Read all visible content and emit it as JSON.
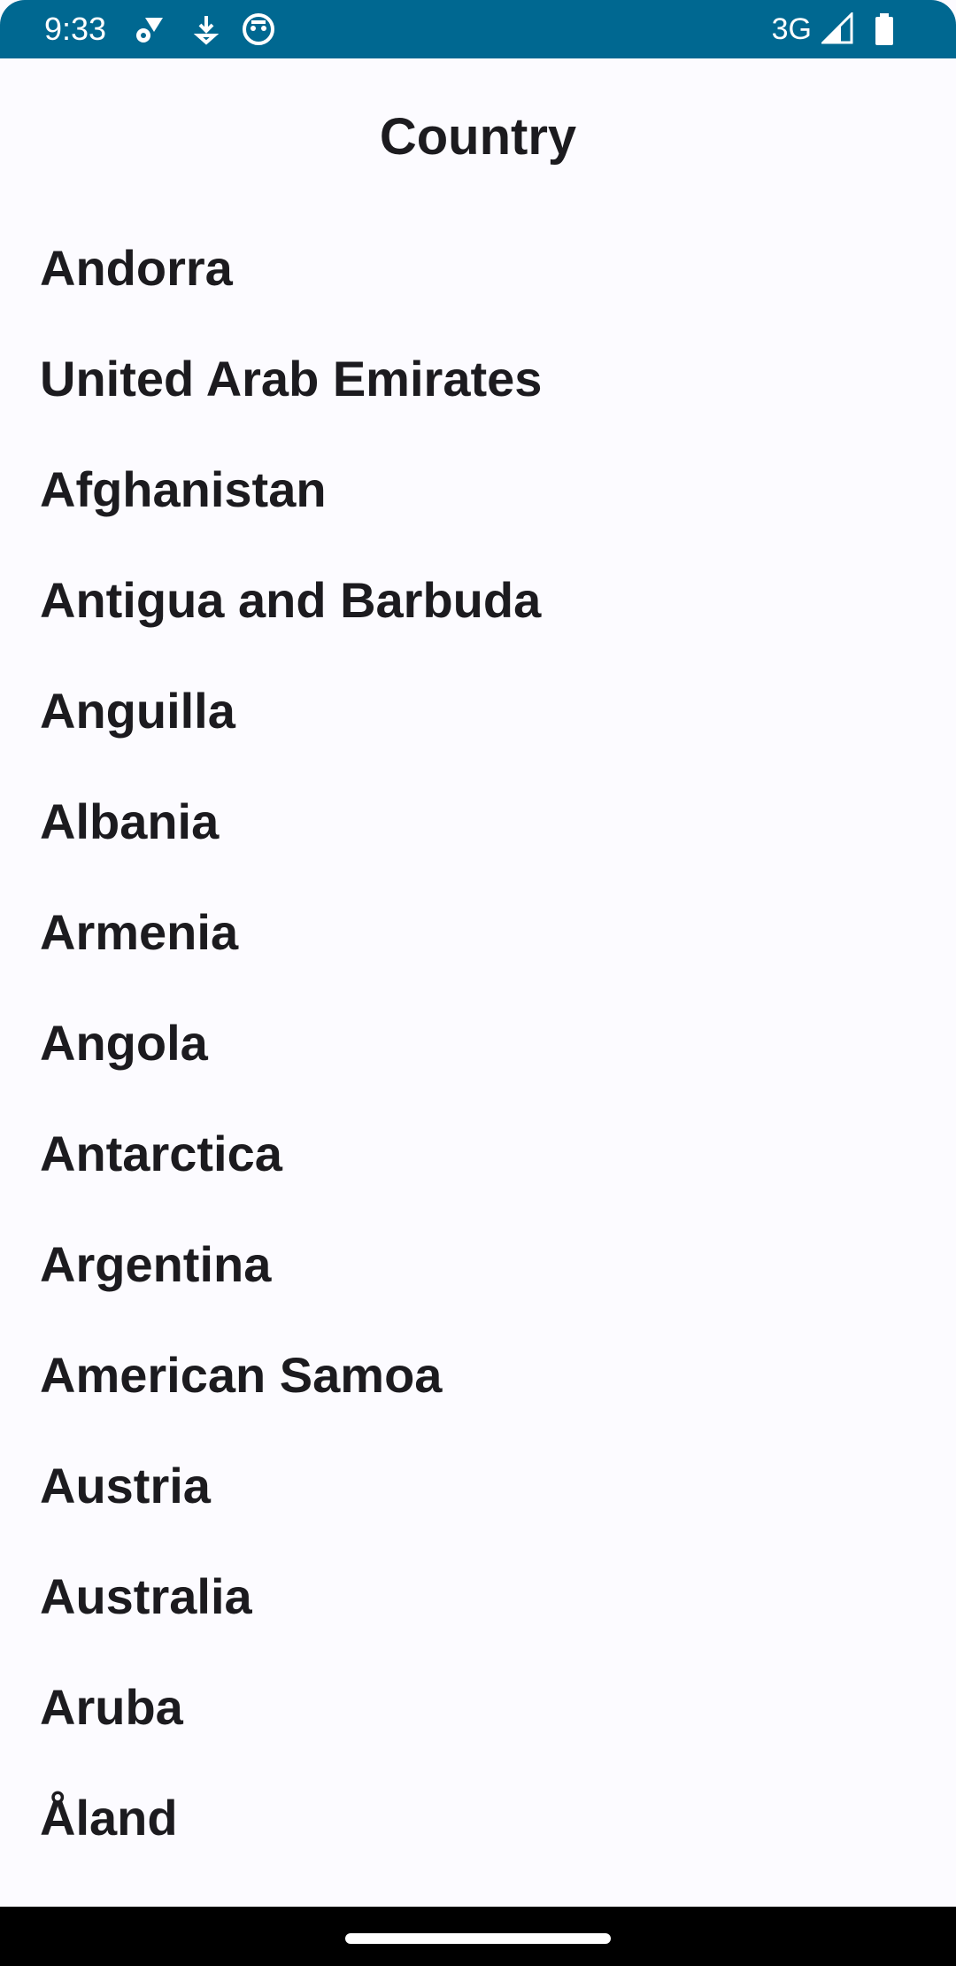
{
  "status_bar": {
    "time": "9:33",
    "network": "3G",
    "icons": [
      "settings-wifi-icon",
      "download-icon",
      "robot-icon",
      "signal-icon",
      "battery-icon"
    ],
    "background_color": "#006891"
  },
  "page": {
    "title": "Country"
  },
  "countries": [
    "Andorra",
    "United Arab Emirates",
    "Afghanistan",
    "Antigua and Barbuda",
    "Anguilla",
    "Albania",
    "Armenia",
    "Angola",
    "Antarctica",
    "Argentina",
    "American Samoa",
    "Austria",
    "Australia",
    "Aruba",
    "Åland"
  ]
}
